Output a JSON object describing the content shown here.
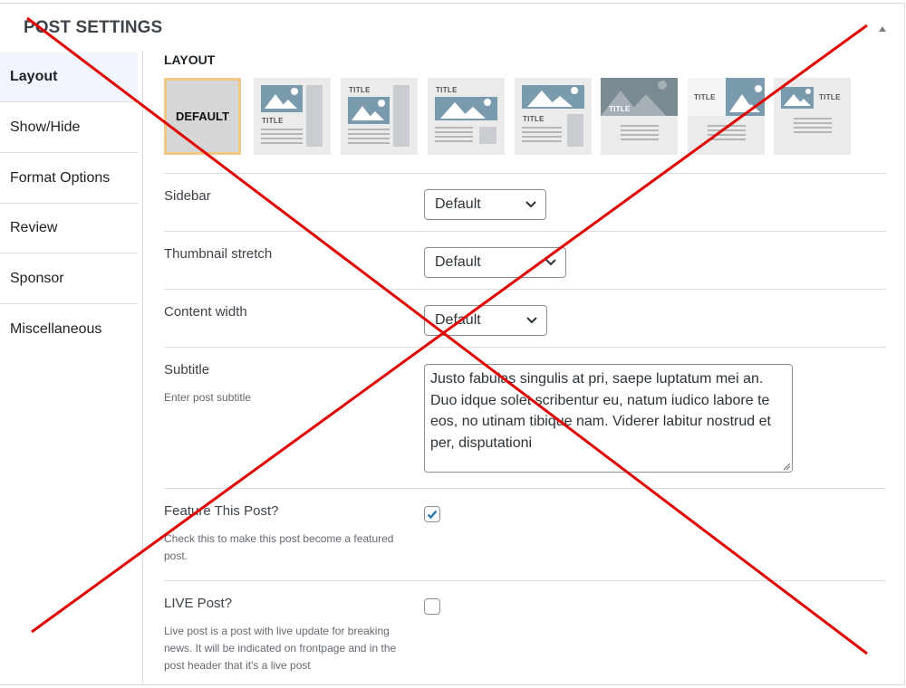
{
  "panel": {
    "title": "POST SETTINGS",
    "collapse_icon": "triangle-up-icon"
  },
  "tabs": [
    {
      "label": "Layout",
      "active": true
    },
    {
      "label": "Show/Hide",
      "active": false
    },
    {
      "label": "Format Options",
      "active": false
    },
    {
      "label": "Review",
      "active": false
    },
    {
      "label": "Sponsor",
      "active": false
    },
    {
      "label": "Miscellaneous",
      "active": false
    }
  ],
  "layout": {
    "label": "LAYOUT",
    "options": [
      {
        "name": "default",
        "label": "DEFAULT",
        "selected": true
      },
      {
        "name": "image-left-title-below-sidebar",
        "title": "TITLE"
      },
      {
        "name": "title-top-image-sidebar",
        "title": "TITLE"
      },
      {
        "name": "title-top-wide-image-small-box",
        "title": "TITLE"
      },
      {
        "name": "image-top-title-below-sidebar",
        "title": "TITLE"
      },
      {
        "name": "full-image-title-overlay",
        "title": "TITLE"
      },
      {
        "name": "title-left-image-right",
        "title": "TITLE"
      },
      {
        "name": "image-left-title-right",
        "title": "TITLE"
      }
    ]
  },
  "fields": {
    "sidebar": {
      "label": "Sidebar",
      "value": "Default"
    },
    "thumbnail_stretch": {
      "label": "Thumbnail stretch",
      "value": "Default"
    },
    "content_width": {
      "label": "Content width",
      "value": "Default"
    },
    "subtitle": {
      "label": "Subtitle",
      "description": "Enter post subtitle",
      "value": "Justo fabulas singulis at pri, saepe luptatum mei an. Duo idque solet scribentur eu, natum iudico labore te eos, no utinam tibique nam. Viderer labitur nostrud et per, disputationi"
    },
    "feature_post": {
      "label": "Feature This Post?",
      "description": "Check this to make this post become a featured post.",
      "checked": true
    },
    "live_post": {
      "label": "LIVE Post?",
      "description": "Live post is a post with live update for breaking news. It will be indicated on frontpage and in the post header that it's a live post",
      "checked": false
    }
  },
  "colors": {
    "accent": "#2271b1",
    "selected_border": "#f2c887",
    "overlay_cross": "#e00000",
    "thumb_image": "#7a9aae"
  }
}
